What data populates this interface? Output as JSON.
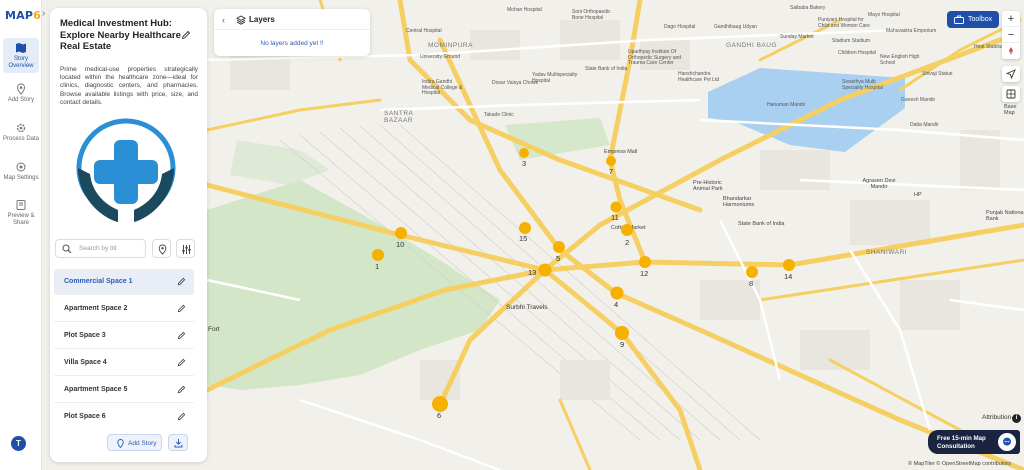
{
  "app": {
    "logo_main": "MAP",
    "logo_accent": "6",
    "accent_color": "#1f4fa8",
    "marker_color": "#f5b000"
  },
  "rail": {
    "items": [
      {
        "label": "Story Overview",
        "icon": "map-icon",
        "active": true
      },
      {
        "label": "Add Story",
        "icon": "pin-icon",
        "active": false
      },
      {
        "label": "Process Data",
        "icon": "gear-icon",
        "active": false
      },
      {
        "label": "Map Settings",
        "icon": "settings-icon",
        "active": false
      },
      {
        "label": "Preview & Share",
        "icon": "preview-icon",
        "active": false
      }
    ],
    "avatar": "T"
  },
  "story": {
    "title": "Medical Investment Hub: Explore Nearby Healthcare Real Estate",
    "description": "Prime medical-use properties strategically located within the healthcare zone—ideal for clinics, diagnostic centers, and pharmacies. Browse available listings with price, size, and contact details.",
    "search_placeholder": "Search by titl",
    "items": [
      {
        "label": "Commercial Space 1",
        "active": true
      },
      {
        "label": "Apartment Space 2",
        "active": false
      },
      {
        "label": "Plot Space 3",
        "active": false
      },
      {
        "label": "Villa Space 4",
        "active": false
      },
      {
        "label": "Apartment Space 5",
        "active": false
      },
      {
        "label": "Plot Space 6",
        "active": false
      }
    ],
    "add_story_label": "Add Story"
  },
  "layers": {
    "title": "Layers",
    "empty_text": "No layers added yet !!"
  },
  "toolbox": {
    "label": "Toolbox"
  },
  "map_controls": {
    "zoom_in": "+",
    "zoom_out": "−",
    "basemap_label": "Base Map"
  },
  "attribution": {
    "label": "Attribution",
    "info": "i",
    "credits": "© MapTiler © OpenStreetMap contributors"
  },
  "consult": {
    "label": "Free 15-min Map Consultation"
  },
  "map_labels": {
    "areas": [
      "MOMINPURA",
      "GANDHI BAUG",
      "SANTRA BAZAAR",
      "SHANIWARI"
    ],
    "pois": [
      "Mohan Hospital",
      "Soni Orthopaedic Bone Hospital",
      "Saibaba Bakery",
      "University Ground",
      "Central Hospital",
      "Gandhibaug Udyan",
      "Dago Hospital",
      "Puniyani Hospital for Child and Women Care",
      "Sunday Market",
      "Stadium Stadium",
      "Mahavastra Emporium",
      "Mayo Hospital",
      "Heat Stabilizer",
      "Indira Gandhi Medical College & Hospital",
      "Yadav Multispecialty Hospital",
      "Dosar Vaisya Chowk",
      "Upadhyay Institute Of Orthopedic Surgery and Trauma Care Center",
      "State Bank of India",
      "Hanshchandra Healthcare Pvt Ltd",
      "Children Hospital",
      "New English High School",
      "Shivaji Statue",
      "Swasthya Multi Speciality Hospital",
      "Takade Clinic",
      "Hanuman Mandir",
      "Ganesh Mandir",
      "Datta Mandir",
      "Base Map",
      "Empress Mall",
      "Pre-Historic Animal Park",
      "Bhandarkar Harmoniums",
      "Agrasen Devi Mandir",
      "HP",
      "Punjab National Bank",
      "Cotton Market",
      "State Bank of India",
      "Surbhi Travels",
      "Fort"
    ]
  },
  "markers": [
    "1",
    "2",
    "3",
    "4",
    "5",
    "6",
    "7",
    "8",
    "9",
    "10",
    "11",
    "12",
    "13",
    "14",
    "15"
  ]
}
